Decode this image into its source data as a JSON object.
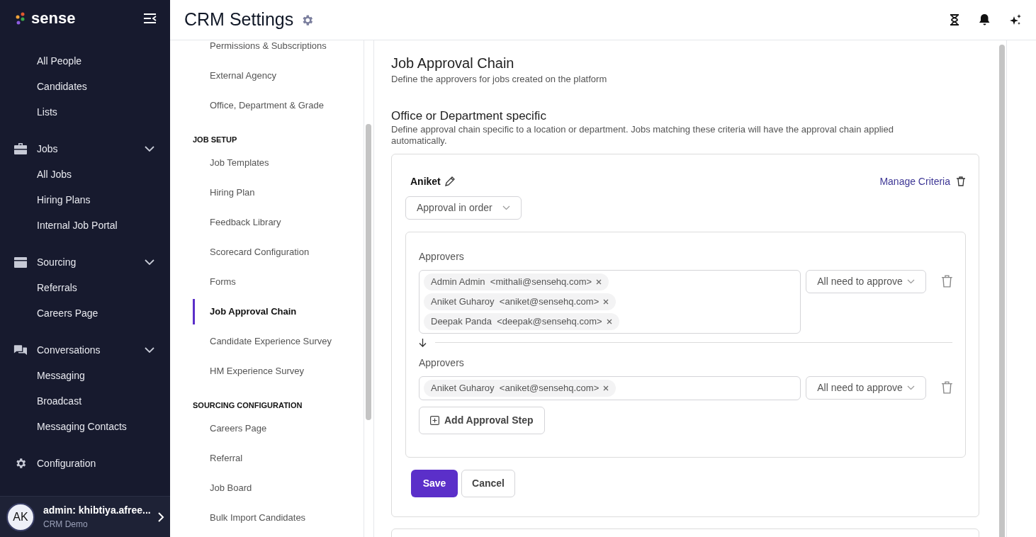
{
  "brand": {
    "name": "sense"
  },
  "sidebar": {
    "sections": [
      {
        "items": [
          "All People",
          "Candidates",
          "Lists"
        ]
      },
      {
        "label": "Jobs",
        "expanded": true,
        "items": [
          "All Jobs",
          "Hiring Plans",
          "Internal Job Portal"
        ]
      },
      {
        "label": "Sourcing",
        "expanded": true,
        "items": [
          "Referrals",
          "Careers Page"
        ]
      },
      {
        "label": "Conversations",
        "expanded": true,
        "items": [
          "Messaging",
          "Broadcast",
          "Messaging Contacts"
        ]
      },
      {
        "label": "Configuration"
      }
    ],
    "user": {
      "initials": "AK",
      "name": "admin: khibtiya.afree...",
      "org": "CRM Demo"
    }
  },
  "header": {
    "title": "CRM Settings"
  },
  "settings_nav": {
    "groups": [
      {
        "items": [
          {
            "label": "Permissions & Subscriptions",
            "selected": false
          },
          {
            "label": "External Agency",
            "selected": false
          },
          {
            "label": "Office, Department & Grade",
            "selected": false
          }
        ]
      },
      {
        "heading": "JOB SETUP",
        "items": [
          {
            "label": "Job Templates",
            "selected": false
          },
          {
            "label": "Hiring Plan",
            "selected": false
          },
          {
            "label": "Feedback Library",
            "selected": false
          },
          {
            "label": "Scorecard Configuration",
            "selected": false
          },
          {
            "label": "Forms",
            "selected": false
          },
          {
            "label": "Job Approval Chain",
            "selected": true
          },
          {
            "label": "Candidate Experience Survey",
            "selected": false
          },
          {
            "label": "HM Experience Survey",
            "selected": false
          }
        ]
      },
      {
        "heading": "SOURCING CONFIGURATION",
        "items": [
          {
            "label": "Careers Page",
            "selected": false
          },
          {
            "label": "Referral",
            "selected": false
          },
          {
            "label": "Job Board",
            "selected": false
          },
          {
            "label": "Bulk Import Candidates",
            "selected": false
          }
        ]
      }
    ]
  },
  "page": {
    "title": "Job Approval Chain",
    "description": "Define the approvers for jobs created on the platform",
    "section_title": "Office or Department specific",
    "section_description": "Define approval chain specific to a location or department. Jobs matching these criteria will have the approval chain applied automatically.",
    "chain": {
      "name": "Aniket",
      "manage_link": "Manage Criteria",
      "mode": "Approval in order",
      "steps": [
        {
          "label": "Approvers",
          "approvers": [
            {
              "name": "Admin Admin",
              "email": "<mithali@sensehq.com>"
            },
            {
              "name": "Aniket Guharoy",
              "email": "<aniket@sensehq.com>"
            },
            {
              "name": "Deepak Panda",
              "email": "<deepak@sensehq.com>"
            }
          ],
          "rule": "All need to approve"
        },
        {
          "label": "Approvers",
          "approvers": [
            {
              "name": "Aniket Guharoy",
              "email": "<aniket@sensehq.com>"
            }
          ],
          "rule": "All need to approve"
        }
      ],
      "add_step": "Add Approval Step",
      "save": "Save",
      "cancel": "Cancel"
    }
  }
}
